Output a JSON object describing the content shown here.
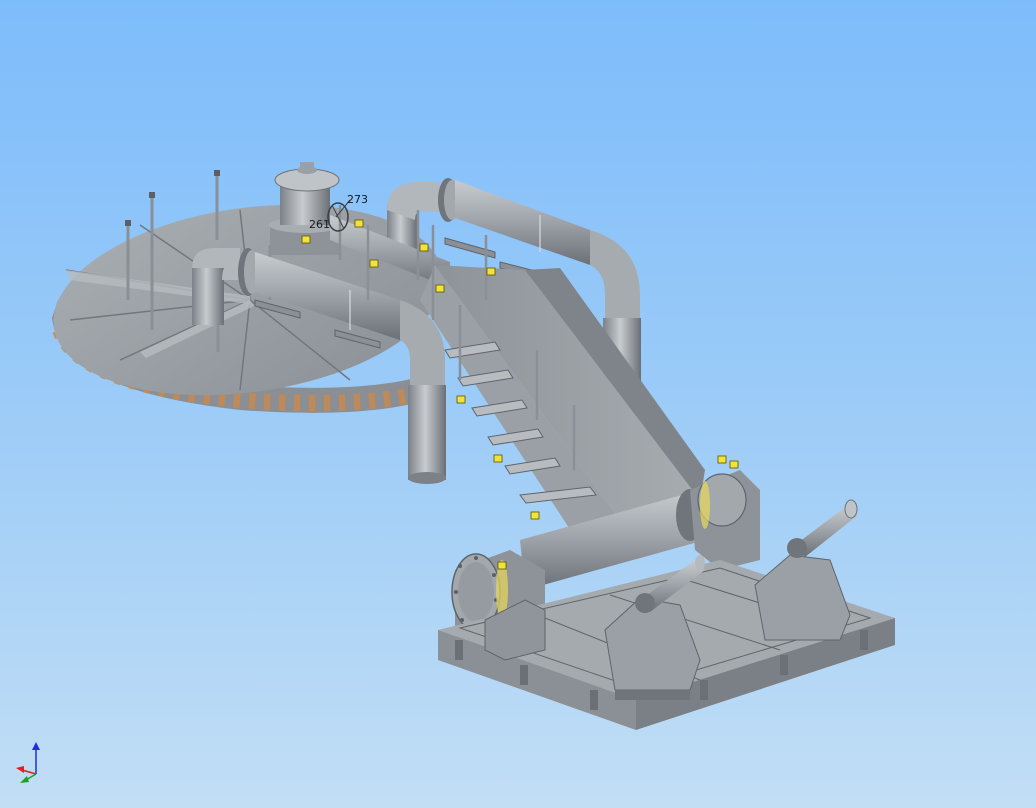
{
  "annotations": {
    "dim_a": "273",
    "dim_b": "261"
  },
  "colors": {
    "background_top": "#7dbcfb",
    "background_bottom": "#c2def5",
    "steel": "#9ea3a8",
    "steel_dark": "#6f757b",
    "steel_light": "#c3c7cb",
    "rim_accent": "#c98a4e",
    "constraint_marker": "#f2e33a",
    "axis_x": "#e02020",
    "axis_y": "#20a020",
    "axis_z": "#2030d0"
  },
  "icons": {
    "view_cube": "triad-axes-icon",
    "constraint": "padlock-marker-icon"
  }
}
